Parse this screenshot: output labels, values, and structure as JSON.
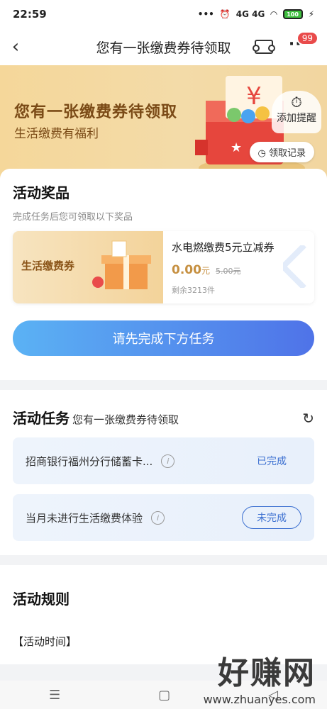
{
  "status_bar": {
    "time": "22:59",
    "signal": "4G 4G",
    "battery": "100"
  },
  "nav": {
    "back_icon": "chevron-left",
    "title": "您有一张缴费券待领取",
    "badge": "99"
  },
  "banner": {
    "title": "您有一张缴费券待领取",
    "subtitle": "生活缴费有福利",
    "reminder_label": "添加提醒",
    "record_label": "领取记录"
  },
  "prizes": {
    "title": "活动奖品",
    "subtitle": "完成任务后您可领取以下奖品",
    "item": {
      "image_label": "生活缴费券",
      "name": "水电燃缴费5元立减券",
      "price": "0.00",
      "price_unit": "元",
      "original_price": "5.00元",
      "remaining": "剩余3213件"
    },
    "cta": "请先完成下方任务"
  },
  "tasks": {
    "title": "活动任务",
    "subtitle": "您有一张缴费券待领取",
    "items": [
      {
        "name": "招商银行福州分行储蓄卡...",
        "status": "已完成"
      },
      {
        "name": "当月未进行生活缴费体验",
        "status": "未完成"
      }
    ]
  },
  "rules": {
    "title": "活动规则",
    "item": "【活动时间】"
  },
  "watermark": {
    "big": "好赚网",
    "small": "www.zhuanyes.com"
  },
  "colors": {
    "accent": "#3b6fd0",
    "gold": "#c69041",
    "banner": "#f3dba8"
  }
}
